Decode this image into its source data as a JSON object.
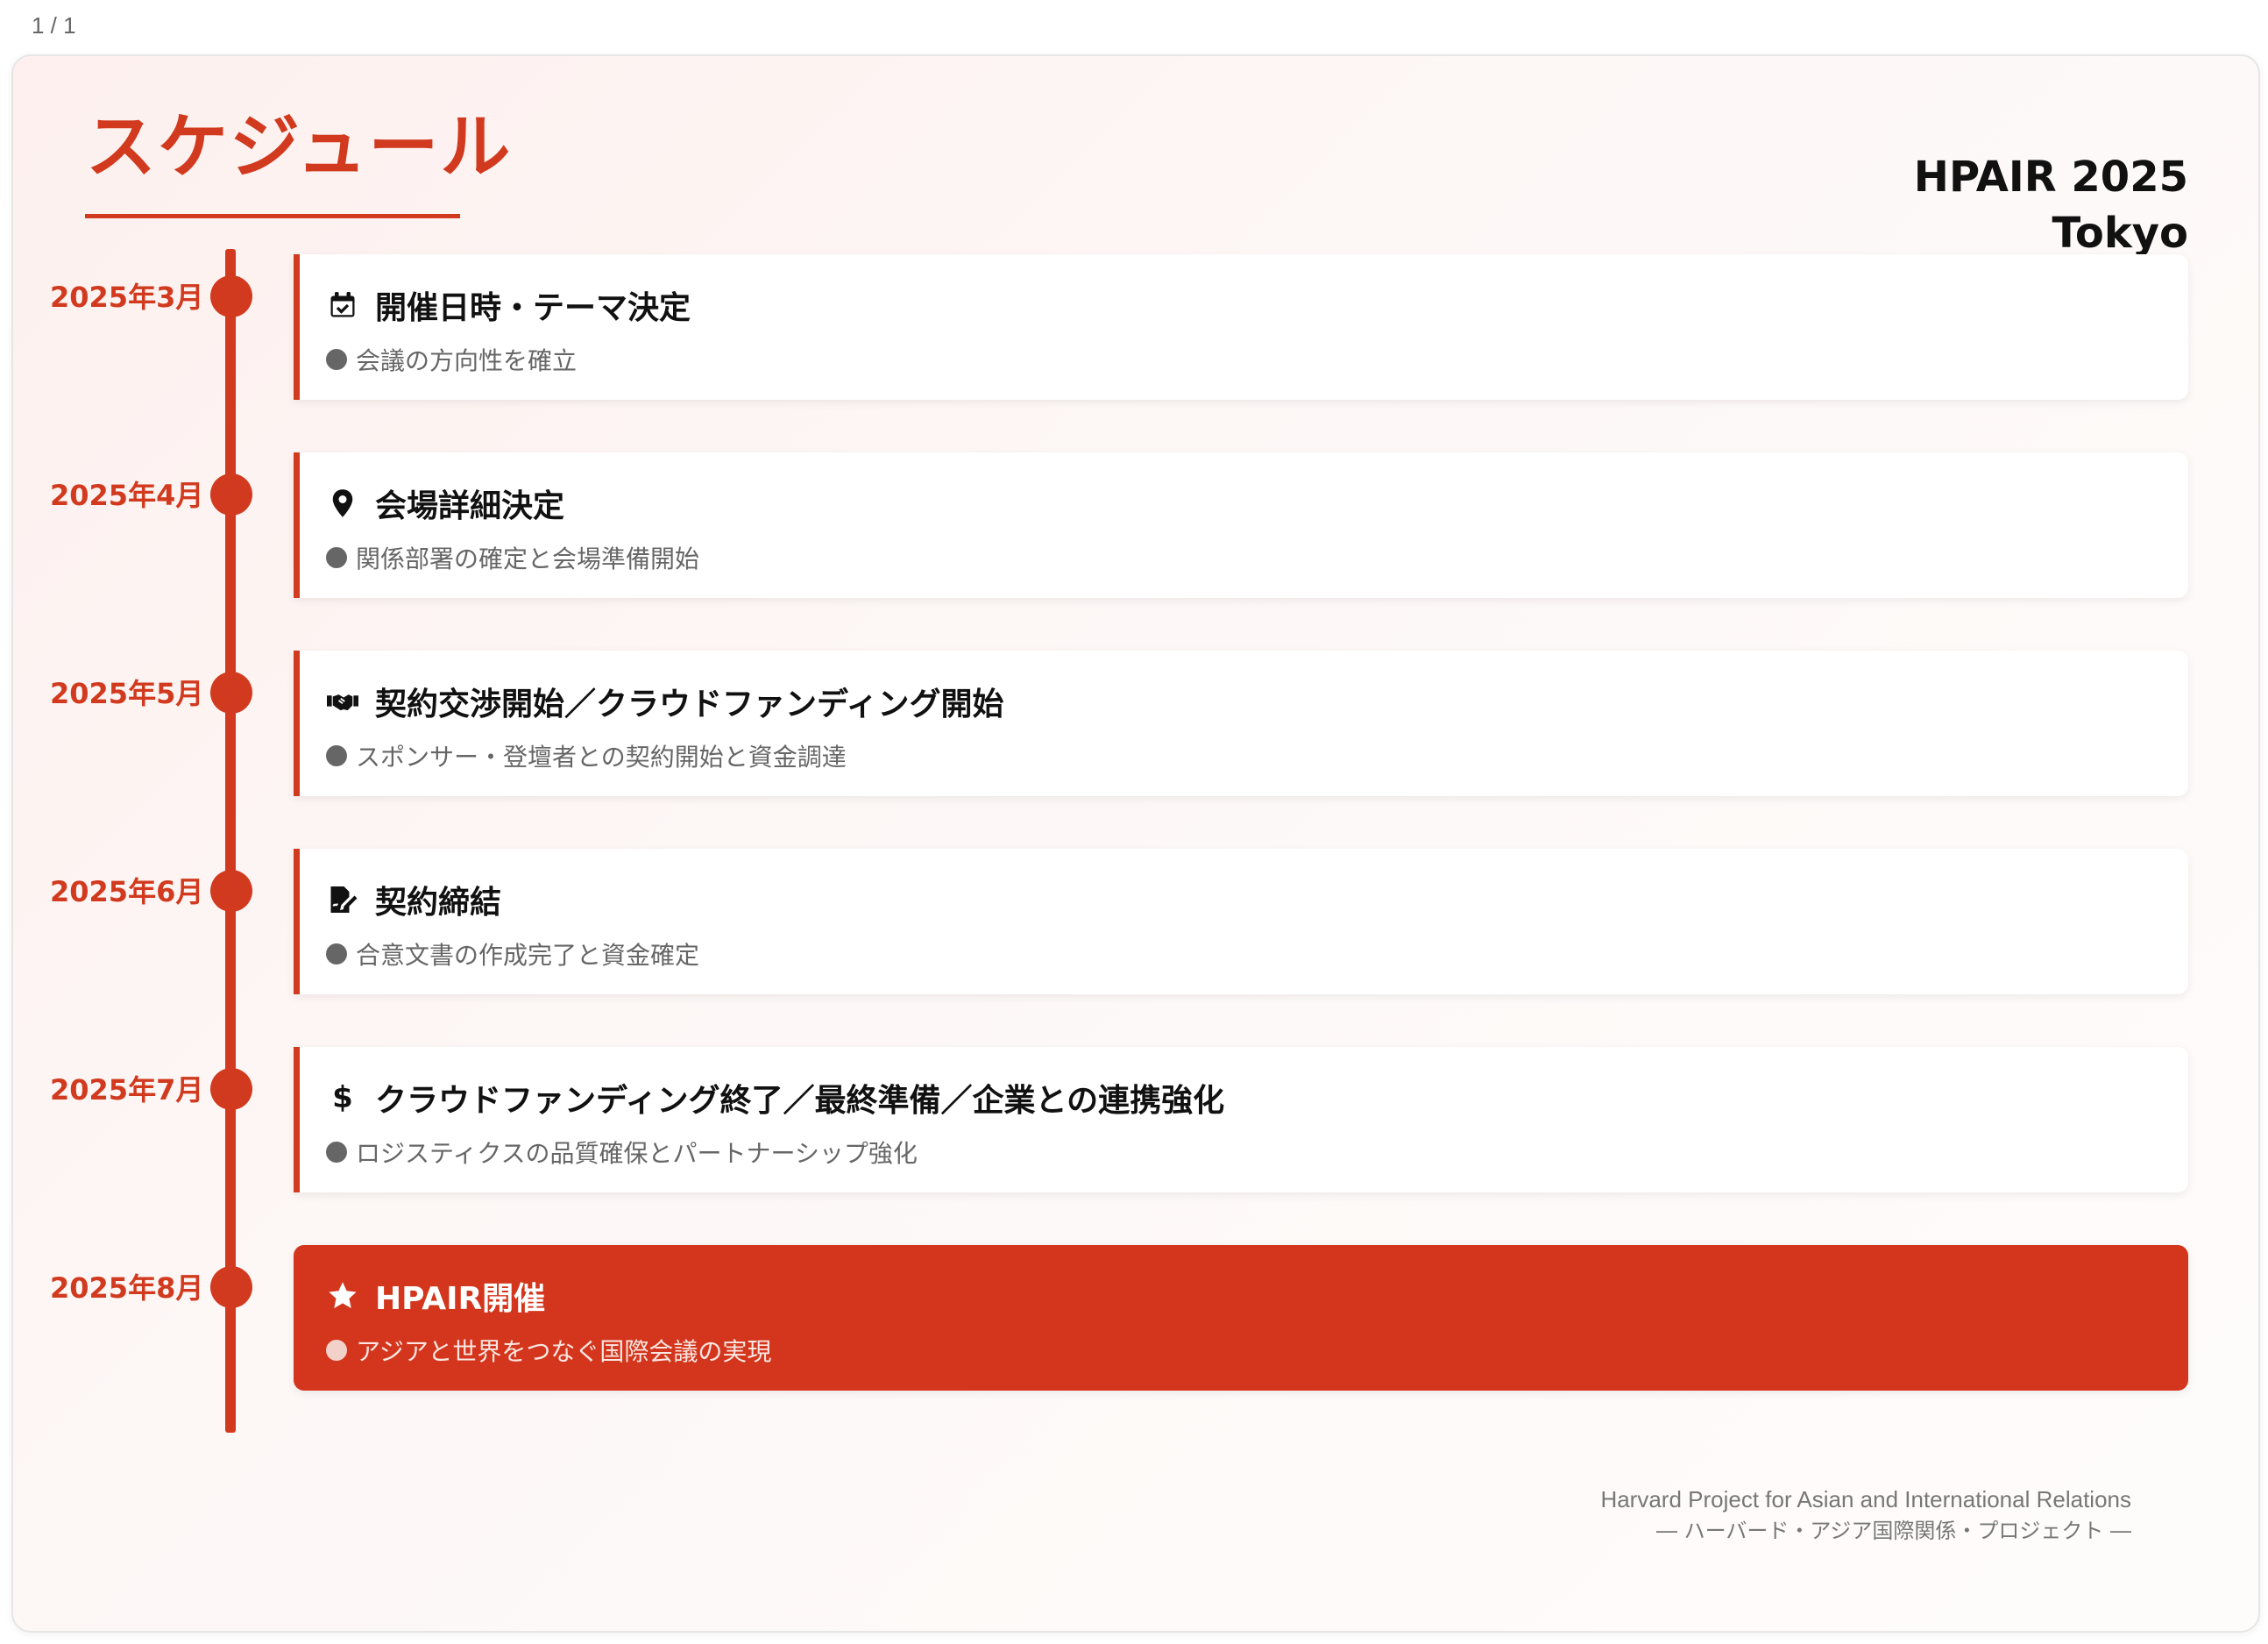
{
  "viewer": {
    "page_counter": "1 / 1"
  },
  "slide": {
    "title": "スケジュール",
    "brand_line1": "HPAIR 2025",
    "brand_line2": "Tokyo",
    "accent_color": "#d13a1e"
  },
  "timeline": [
    {
      "date": "2025年3月",
      "icon": "calendar-check-icon",
      "title": "開催日時・テーマ決定",
      "desc": "会議の方向性を確立"
    },
    {
      "date": "2025年4月",
      "icon": "map-pin-icon",
      "title": "会場詳細決定",
      "desc": "関係部署の確定と会場準備開始"
    },
    {
      "date": "2025年5月",
      "icon": "handshake-icon",
      "title": "契約交渉開始／クラウドファンディング開始",
      "desc": "スポンサー・登壇者との契約開始と資金調達"
    },
    {
      "date": "2025年6月",
      "icon": "file-signature-icon",
      "title": "契約締結",
      "desc": "合意文書の作成完了と資金確定"
    },
    {
      "date": "2025年7月",
      "icon": "dollar-icon",
      "icon_text": "$",
      "title": "クラウドファンディング終了／最終準備／企業との連携強化",
      "desc": "ロジスティクスの品質確保とパートナーシップ強化"
    },
    {
      "date": "2025年8月",
      "icon": "star-icon",
      "title": "HPAIR開催",
      "desc": "アジアと世界をつなぐ国際会議の実現",
      "highlight": true
    }
  ],
  "footer": {
    "line1": "Harvard Project for Asian and International Relations",
    "line2": "― ハーバード・アジア国際関係・プロジェクト ―"
  }
}
